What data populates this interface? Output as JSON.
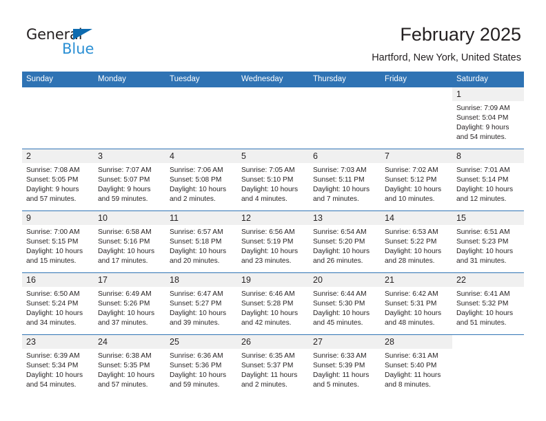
{
  "brand": {
    "name_part1": "General",
    "name_part2": "Blue",
    "triangle_color": "#0d6bb0",
    "blue_color": "#2a8fd4"
  },
  "header": {
    "title": "February 2025",
    "location": "Hartford, New York, United States"
  },
  "theme": {
    "header_blue": "#2f73b4",
    "daynum_band": "#f0f0f0",
    "text": "#231f20"
  },
  "weekdays": [
    "Sunday",
    "Monday",
    "Tuesday",
    "Wednesday",
    "Thursday",
    "Friday",
    "Saturday"
  ],
  "weeks": [
    [
      {
        "day": "",
        "lines": []
      },
      {
        "day": "",
        "lines": []
      },
      {
        "day": "",
        "lines": []
      },
      {
        "day": "",
        "lines": []
      },
      {
        "day": "",
        "lines": []
      },
      {
        "day": "",
        "lines": []
      },
      {
        "day": "1",
        "lines": [
          "Sunrise: 7:09 AM",
          "Sunset: 5:04 PM",
          "Daylight: 9 hours",
          "and 54 minutes."
        ]
      }
    ],
    [
      {
        "day": "2",
        "lines": [
          "Sunrise: 7:08 AM",
          "Sunset: 5:05 PM",
          "Daylight: 9 hours",
          "and 57 minutes."
        ]
      },
      {
        "day": "3",
        "lines": [
          "Sunrise: 7:07 AM",
          "Sunset: 5:07 PM",
          "Daylight: 9 hours",
          "and 59 minutes."
        ]
      },
      {
        "day": "4",
        "lines": [
          "Sunrise: 7:06 AM",
          "Sunset: 5:08 PM",
          "Daylight: 10 hours",
          "and 2 minutes."
        ]
      },
      {
        "day": "5",
        "lines": [
          "Sunrise: 7:05 AM",
          "Sunset: 5:10 PM",
          "Daylight: 10 hours",
          "and 4 minutes."
        ]
      },
      {
        "day": "6",
        "lines": [
          "Sunrise: 7:03 AM",
          "Sunset: 5:11 PM",
          "Daylight: 10 hours",
          "and 7 minutes."
        ]
      },
      {
        "day": "7",
        "lines": [
          "Sunrise: 7:02 AM",
          "Sunset: 5:12 PM",
          "Daylight: 10 hours",
          "and 10 minutes."
        ]
      },
      {
        "day": "8",
        "lines": [
          "Sunrise: 7:01 AM",
          "Sunset: 5:14 PM",
          "Daylight: 10 hours",
          "and 12 minutes."
        ]
      }
    ],
    [
      {
        "day": "9",
        "lines": [
          "Sunrise: 7:00 AM",
          "Sunset: 5:15 PM",
          "Daylight: 10 hours",
          "and 15 minutes."
        ]
      },
      {
        "day": "10",
        "lines": [
          "Sunrise: 6:58 AM",
          "Sunset: 5:16 PM",
          "Daylight: 10 hours",
          "and 17 minutes."
        ]
      },
      {
        "day": "11",
        "lines": [
          "Sunrise: 6:57 AM",
          "Sunset: 5:18 PM",
          "Daylight: 10 hours",
          "and 20 minutes."
        ]
      },
      {
        "day": "12",
        "lines": [
          "Sunrise: 6:56 AM",
          "Sunset: 5:19 PM",
          "Daylight: 10 hours",
          "and 23 minutes."
        ]
      },
      {
        "day": "13",
        "lines": [
          "Sunrise: 6:54 AM",
          "Sunset: 5:20 PM",
          "Daylight: 10 hours",
          "and 26 minutes."
        ]
      },
      {
        "day": "14",
        "lines": [
          "Sunrise: 6:53 AM",
          "Sunset: 5:22 PM",
          "Daylight: 10 hours",
          "and 28 minutes."
        ]
      },
      {
        "day": "15",
        "lines": [
          "Sunrise: 6:51 AM",
          "Sunset: 5:23 PM",
          "Daylight: 10 hours",
          "and 31 minutes."
        ]
      }
    ],
    [
      {
        "day": "16",
        "lines": [
          "Sunrise: 6:50 AM",
          "Sunset: 5:24 PM",
          "Daylight: 10 hours",
          "and 34 minutes."
        ]
      },
      {
        "day": "17",
        "lines": [
          "Sunrise: 6:49 AM",
          "Sunset: 5:26 PM",
          "Daylight: 10 hours",
          "and 37 minutes."
        ]
      },
      {
        "day": "18",
        "lines": [
          "Sunrise: 6:47 AM",
          "Sunset: 5:27 PM",
          "Daylight: 10 hours",
          "and 39 minutes."
        ]
      },
      {
        "day": "19",
        "lines": [
          "Sunrise: 6:46 AM",
          "Sunset: 5:28 PM",
          "Daylight: 10 hours",
          "and 42 minutes."
        ]
      },
      {
        "day": "20",
        "lines": [
          "Sunrise: 6:44 AM",
          "Sunset: 5:30 PM",
          "Daylight: 10 hours",
          "and 45 minutes."
        ]
      },
      {
        "day": "21",
        "lines": [
          "Sunrise: 6:42 AM",
          "Sunset: 5:31 PM",
          "Daylight: 10 hours",
          "and 48 minutes."
        ]
      },
      {
        "day": "22",
        "lines": [
          "Sunrise: 6:41 AM",
          "Sunset: 5:32 PM",
          "Daylight: 10 hours",
          "and 51 minutes."
        ]
      }
    ],
    [
      {
        "day": "23",
        "lines": [
          "Sunrise: 6:39 AM",
          "Sunset: 5:34 PM",
          "Daylight: 10 hours",
          "and 54 minutes."
        ]
      },
      {
        "day": "24",
        "lines": [
          "Sunrise: 6:38 AM",
          "Sunset: 5:35 PM",
          "Daylight: 10 hours",
          "and 57 minutes."
        ]
      },
      {
        "day": "25",
        "lines": [
          "Sunrise: 6:36 AM",
          "Sunset: 5:36 PM",
          "Daylight: 10 hours",
          "and 59 minutes."
        ]
      },
      {
        "day": "26",
        "lines": [
          "Sunrise: 6:35 AM",
          "Sunset: 5:37 PM",
          "Daylight: 11 hours",
          "and 2 minutes."
        ]
      },
      {
        "day": "27",
        "lines": [
          "Sunrise: 6:33 AM",
          "Sunset: 5:39 PM",
          "Daylight: 11 hours",
          "and 5 minutes."
        ]
      },
      {
        "day": "28",
        "lines": [
          "Sunrise: 6:31 AM",
          "Sunset: 5:40 PM",
          "Daylight: 11 hours",
          "and 8 minutes."
        ]
      },
      {
        "day": "",
        "lines": []
      }
    ]
  ]
}
